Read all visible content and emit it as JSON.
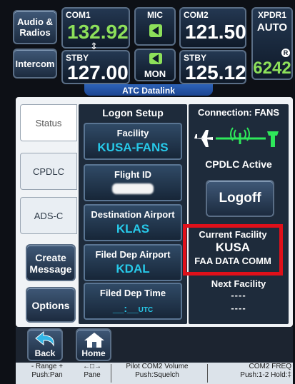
{
  "top": {
    "audio_radios": "Audio & Radios",
    "intercom": "Intercom",
    "com1": {
      "label": "COM1",
      "active": "132.92",
      "stby_label": "STBY",
      "stby": "127.00"
    },
    "mic": {
      "label": "MIC"
    },
    "mon": {
      "label": "MON"
    },
    "com2": {
      "label": "COM2",
      "active": "121.50",
      "stby_label": "STBY",
      "stby": "125.12"
    },
    "xpdr": {
      "label": "XPDR1",
      "mode": "AUTO",
      "code": "6242",
      "reply": "R"
    },
    "page_title": "ATC Datalink"
  },
  "tabs": [
    "Status",
    "CPDLC",
    "ADS-C"
  ],
  "side_buttons": {
    "create_message": "Create Message",
    "options": "Options"
  },
  "logon": {
    "header": "Logon Setup",
    "facility": {
      "label": "Facility",
      "value": "KUSA-FANS"
    },
    "flight_id": {
      "label": "Flight ID"
    },
    "dest": {
      "label": "Destination Airport",
      "value": "KLAS"
    },
    "filed_dep_airport": {
      "label": "Filed Dep Airport",
      "value": "KDAL"
    },
    "filed_dep_time": {
      "label": "Filed Dep Time",
      "value": "__:__",
      "unit": "UTC"
    }
  },
  "connection": {
    "header": "Connection:  FANS",
    "status": "CPDLC Active",
    "logoff": "Logoff",
    "current_facility_label": "Current Facility",
    "current_facility": "KUSA",
    "current_facility_name": "FAA DATA COMM",
    "next_facility_label": "Next Facility",
    "next_facility_1": "----",
    "next_facility_2": "----"
  },
  "bottom": {
    "back": "Back",
    "home": "Home",
    "soft1_top": "- Range +",
    "soft1_bottom": "Push:Pan",
    "soft2_bottom": "Pane",
    "soft3_top": "Pilot COM2 Volume",
    "soft3_bottom": "Push:Squelch",
    "soft4_top": "COM2 FREQ",
    "soft4_bottom": "Push:1-2 Hold:‡"
  },
  "colors": {
    "freq_active": "#8de05a",
    "freq_stby": "#ffffff",
    "value_cyan": "#27c9e9",
    "highlight": "#e0101a"
  }
}
